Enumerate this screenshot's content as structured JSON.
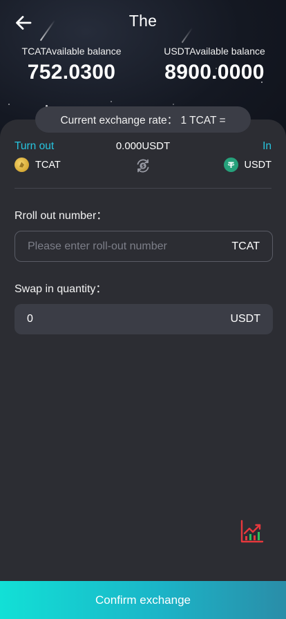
{
  "header": {
    "title": "The"
  },
  "balances": {
    "tcat_label": "TCATAvailable balance",
    "tcat_value": "752.0300",
    "usdt_label": "USDTAvailable balance",
    "usdt_value": "8900.0000"
  },
  "exchange": {
    "rate_text": "Current exchange rate： 1 TCAT =",
    "turn_out_label": "Turn out",
    "out_amount": "0.000USDT",
    "in_label": "In",
    "from_coin": "TCAT",
    "to_coin": "USDT"
  },
  "form": {
    "rollout_label": "Rroll out number：",
    "rollout_placeholder": "Please enter roll-out number",
    "rollout_unit": "TCAT",
    "swapin_label": "Swap in quantity：",
    "swapin_value": "0",
    "swapin_unit": "USDT"
  },
  "footer": {
    "confirm_label": "Confirm exchange"
  },
  "icons": {
    "back": "arrow-left-icon",
    "swap": "exchange-icon",
    "chart": "chart-trend-icon",
    "tcat": "tcat-coin-icon",
    "usdt": "tether-icon"
  },
  "colors": {
    "accent": "#27c6e0",
    "background": "#2c2d33",
    "field": "#3b3d46",
    "button_start": "#12e0d6",
    "button_end": "#2a8da8",
    "chart_red": "#e8383d"
  }
}
